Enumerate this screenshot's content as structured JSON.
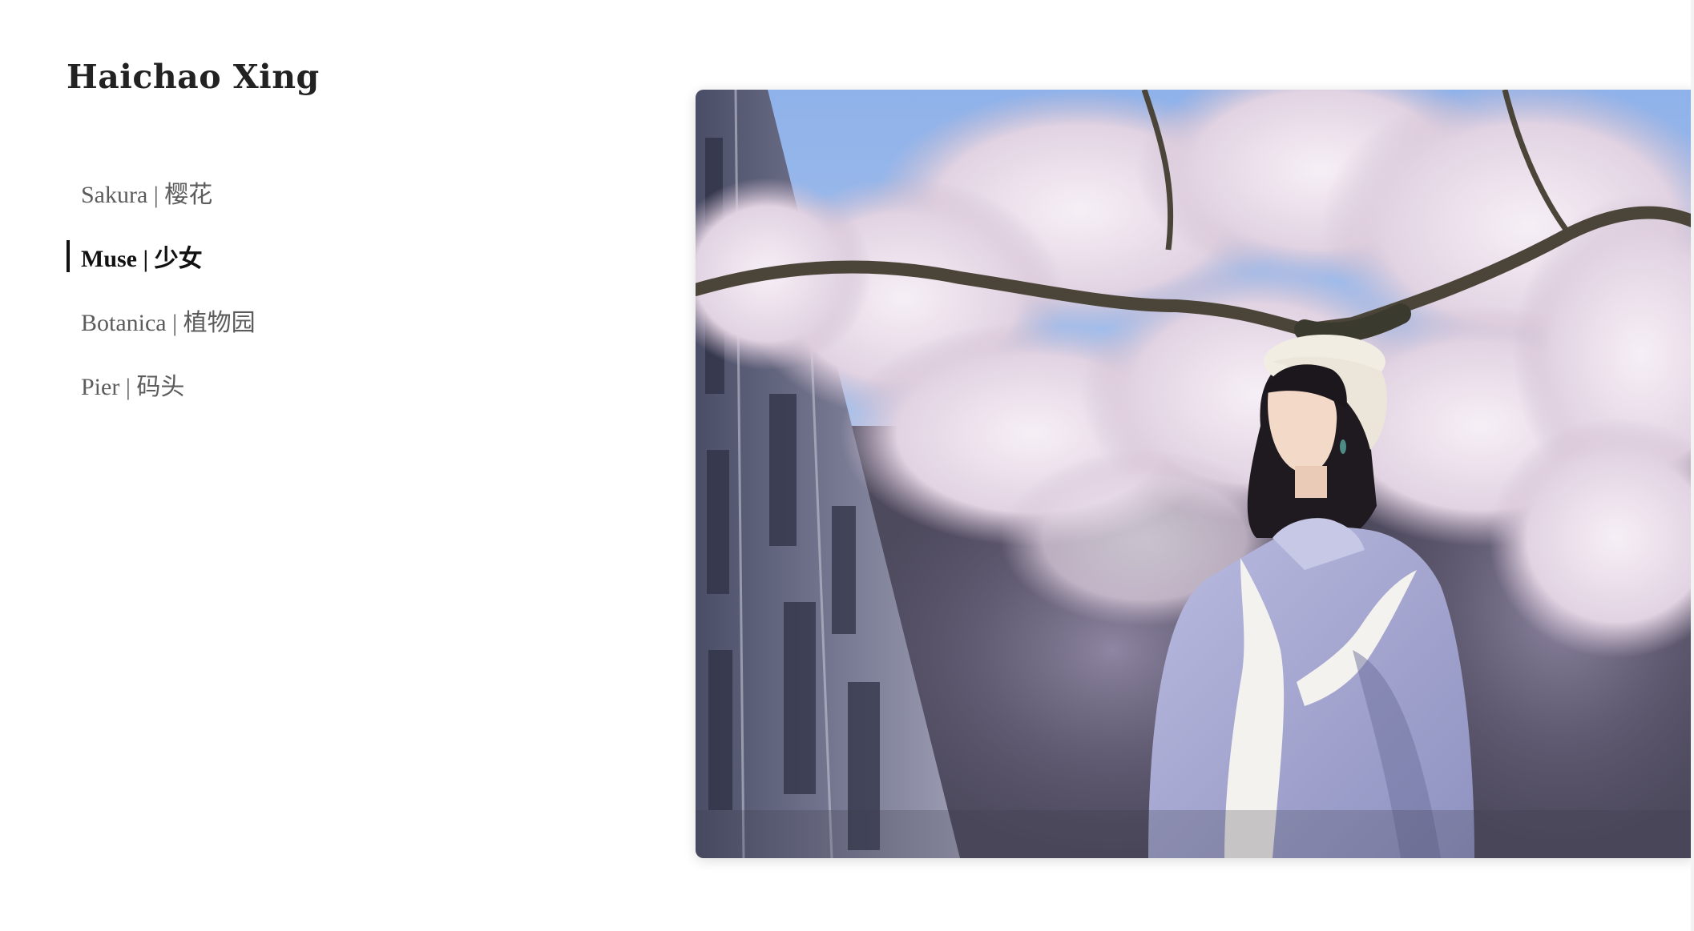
{
  "site": {
    "title": "Haichao Xing"
  },
  "nav": {
    "items": [
      {
        "label": "Sakura | 樱花",
        "active": false
      },
      {
        "label": "Muse | 少女",
        "active": true
      },
      {
        "label": "Botanica | 植物园",
        "active": false
      },
      {
        "label": "Pier | 码头",
        "active": false
      }
    ]
  },
  "colors": {
    "active_indicator": "#111111",
    "inactive_text": "#5c5c5c",
    "title_text": "#222222",
    "sky": "#9ebbe8",
    "blossom": "#efe6ee",
    "jacket": "#aeb0d6"
  }
}
